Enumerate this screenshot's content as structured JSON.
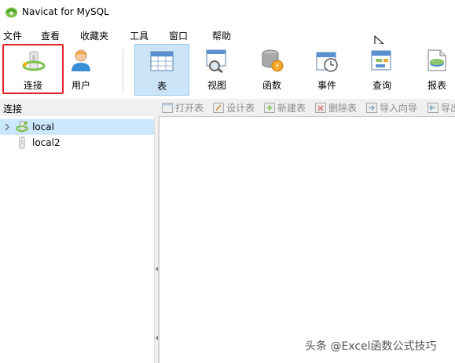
{
  "window": {
    "title": "Navicat for MySQL"
  },
  "menu": [
    "文件",
    "查看",
    "收藏夹",
    "工具",
    "窗口",
    "帮助"
  ],
  "toolbar": {
    "connect": "连接",
    "user": "用户",
    "table": "表",
    "view": "视图",
    "function": "函数",
    "event": "事件",
    "query": "查询",
    "report": "报表"
  },
  "left_panel": {
    "header": "连接"
  },
  "object_toolbar": {
    "open_table": "打开表",
    "design_table": "设计表",
    "new_table": "新建表",
    "delete_table": "删除表",
    "import_wizard": "导入向导",
    "export_wizard": "导出"
  },
  "connections": [
    {
      "name": "local"
    },
    {
      "name": "local2"
    }
  ],
  "watermark": "头条 @Excel函数公式技巧",
  "colors": {
    "selected_bg": "#cce4f7",
    "highlight_border": "#e8202a",
    "tree_selected_bg": "#cce8ff"
  }
}
